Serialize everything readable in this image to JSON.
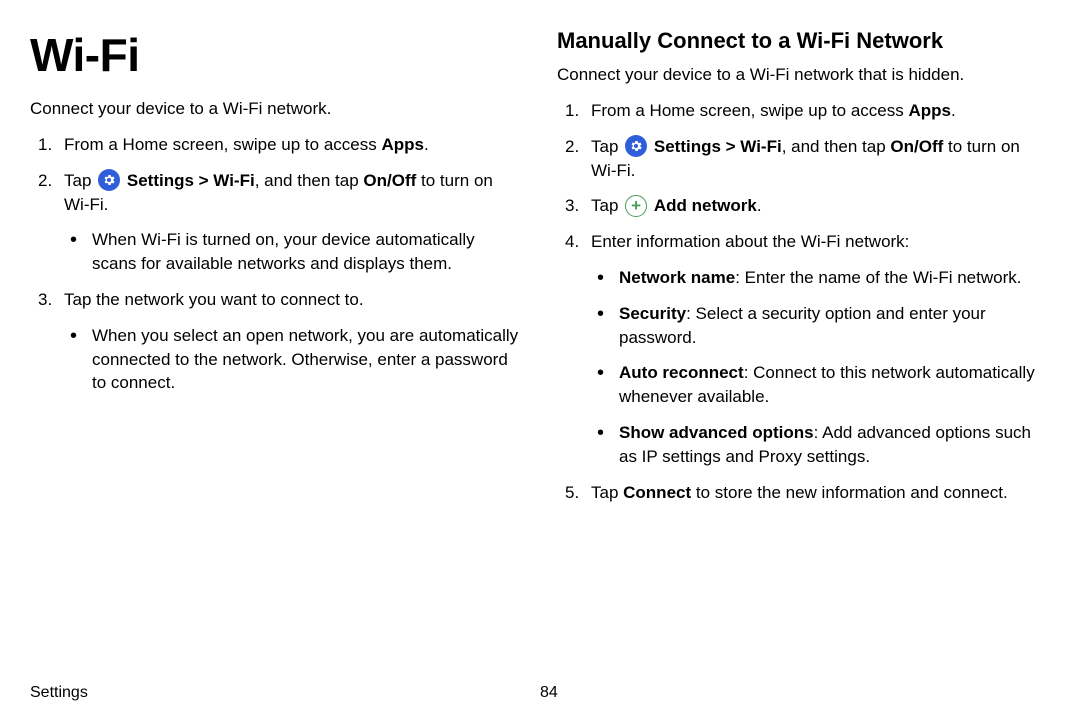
{
  "left": {
    "title": "Wi-Fi",
    "intro": "Connect your device to a Wi-Fi network.",
    "step1_a": "From a Home screen, swipe up to access ",
    "step1_b": "Apps",
    "step1_c": ".",
    "step2_a": "Tap ",
    "step2_b": "Settings > Wi-Fi",
    "step2_c": ", and then tap ",
    "step2_d": "On/Off",
    "step2_e": " to turn on Wi-Fi.",
    "step2_sub": "When Wi-Fi is turned on, your device automatically scans for available networks and displays them.",
    "step3": "Tap the network you want to connect to.",
    "step3_sub": "When you select an open network, you are automatically connected to the network. Otherwise, enter a password to connect."
  },
  "right": {
    "title": "Manually Connect to a Wi-Fi Network",
    "intro": "Connect your device to a Wi-Fi network that is hidden.",
    "step1_a": "From a Home screen, swipe up to access ",
    "step1_b": "Apps",
    "step1_c": ".",
    "step2_a": "Tap ",
    "step2_b": "Settings > Wi-Fi",
    "step2_c": ", and then tap ",
    "step2_d": "On/Off",
    "step2_e": " to turn on Wi-Fi.",
    "step3_a": "Tap ",
    "step3_b": "Add network",
    "step3_c": ".",
    "step4": "Enter information about the Wi-Fi network:",
    "s4a_l": "Network name",
    "s4a_t": ": Enter the name of the Wi-Fi network.",
    "s4b_l": "Security",
    "s4b_t": ": Select a security option and enter your password.",
    "s4c_l": "Auto reconnect",
    "s4c_t": ": Connect to this network automatically whenever available.",
    "s4d_l": "Show advanced options",
    "s4d_t": ": Add advanced options such as IP settings and Proxy settings.",
    "step5_a": "Tap ",
    "step5_b": "Connect",
    "step5_c": " to store the new information and connect."
  },
  "footer": {
    "label": "Settings",
    "page": "84"
  }
}
